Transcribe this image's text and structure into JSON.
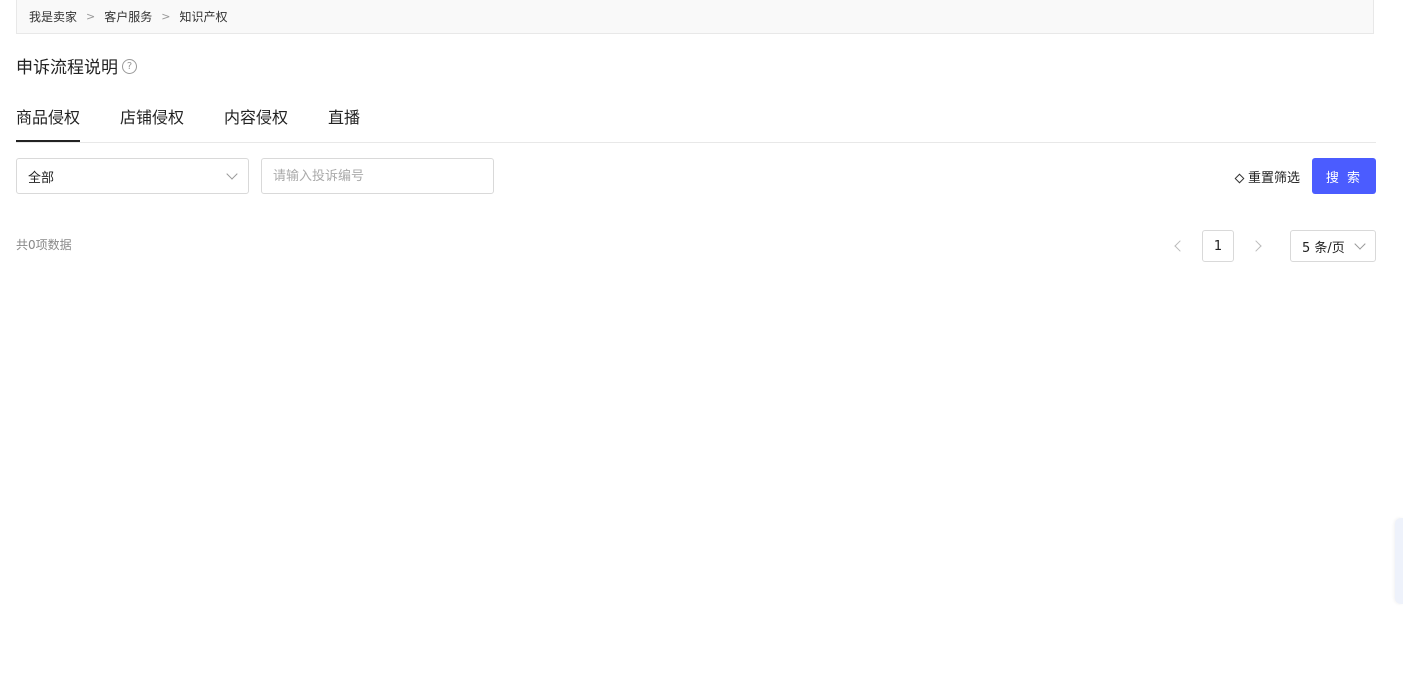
{
  "breadcrumb": {
    "items": [
      "我是卖家",
      "客户服务",
      "知识产权"
    ],
    "separator": ">"
  },
  "header": {
    "title": "申诉流程说明",
    "help_icon": "?"
  },
  "tabs": [
    {
      "label": "商品侵权",
      "active": true
    },
    {
      "label": "店铺侵权",
      "active": false
    },
    {
      "label": "内容侵权",
      "active": false
    },
    {
      "label": "直播",
      "active": false
    }
  ],
  "filters": {
    "status_select": {
      "value": "全部"
    },
    "search": {
      "placeholder": "请输入投诉编号",
      "value": ""
    },
    "reset_label": "重置筛选",
    "search_label": "搜 索"
  },
  "results": {
    "total_text": "共0项数据"
  },
  "pagination": {
    "current_page": "1",
    "page_size": "5 条/页"
  },
  "colors": {
    "primary": "#4b5cff",
    "border": "#d9d9d9",
    "breadcrumb_bg": "#f9f9f9"
  }
}
